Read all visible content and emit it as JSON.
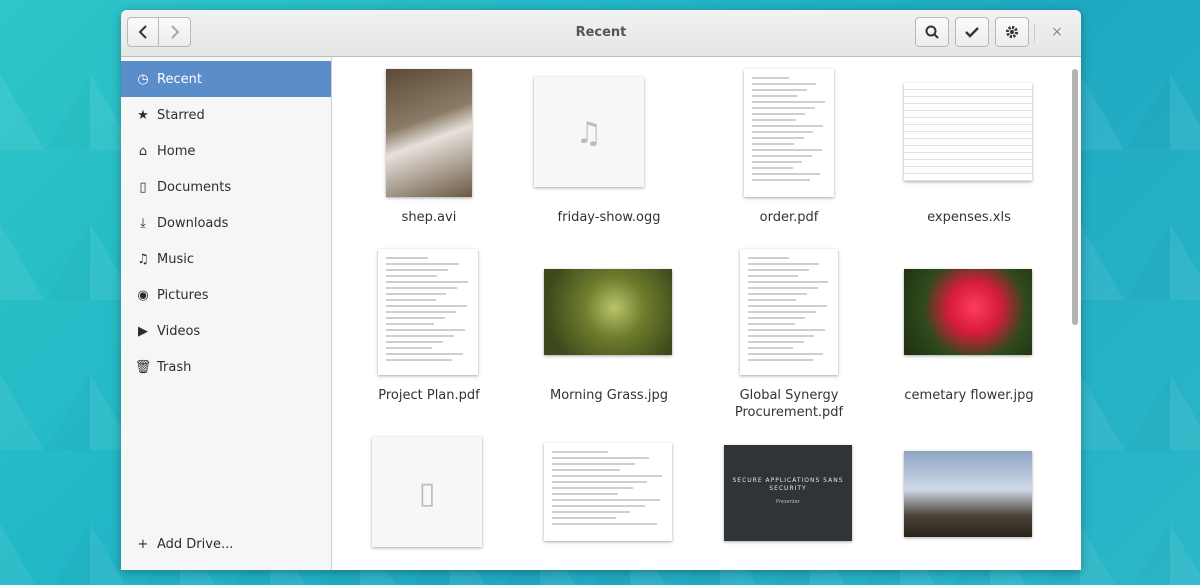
{
  "window": {
    "title": "Recent"
  },
  "headerbar": {
    "back_icon": "chevron-left-icon",
    "forward_icon": "chevron-right-icon",
    "search_icon": "search-icon",
    "select_icon": "check-icon",
    "settings_icon": "gear-icon",
    "close_glyph": "×"
  },
  "sidebar": {
    "items": [
      {
        "label": "Recent",
        "icon": "clock-icon",
        "glyph": "◷"
      },
      {
        "label": "Starred",
        "icon": "star-icon",
        "glyph": "★"
      },
      {
        "label": "Home",
        "icon": "home-icon",
        "glyph": "⌂"
      },
      {
        "label": "Documents",
        "icon": "document-icon",
        "glyph": "▯"
      },
      {
        "label": "Downloads",
        "icon": "download-icon",
        "glyph": "⤓"
      },
      {
        "label": "Music",
        "icon": "music-icon",
        "glyph": "♫"
      },
      {
        "label": "Pictures",
        "icon": "camera-icon",
        "glyph": "◉"
      },
      {
        "label": "Videos",
        "icon": "video-icon",
        "glyph": "▶"
      },
      {
        "label": "Trash",
        "icon": "trash-icon",
        "glyph": "🗑"
      }
    ],
    "add_drive": {
      "label": "Add Drive...",
      "glyph": "+"
    }
  },
  "files": [
    {
      "name": "shep.avi",
      "kind": "video"
    },
    {
      "name": "friday-show.ogg",
      "kind": "audio"
    },
    {
      "name": "order.pdf",
      "kind": "pdf"
    },
    {
      "name": "expenses.xls",
      "kind": "sheet"
    },
    {
      "name": "Project Plan.pdf",
      "kind": "pdf"
    },
    {
      "name": "Morning Grass.jpg",
      "kind": "image"
    },
    {
      "name": "Global Synergy Procurement.pdf",
      "kind": "pdf"
    },
    {
      "name": "cemetary flower.jpg",
      "kind": "image"
    },
    {
      "name": "",
      "kind": "generic"
    },
    {
      "name": "",
      "kind": "diagram"
    },
    {
      "name": "",
      "kind": "slide",
      "slide_title": "SECURE APPLICATIONS SANS SECURITY",
      "slide_subtitle": "Presenter"
    },
    {
      "name": "",
      "kind": "image"
    }
  ],
  "colors": {
    "selection": "#5a8dc9",
    "sidebar_bg": "#f6f6f6"
  }
}
